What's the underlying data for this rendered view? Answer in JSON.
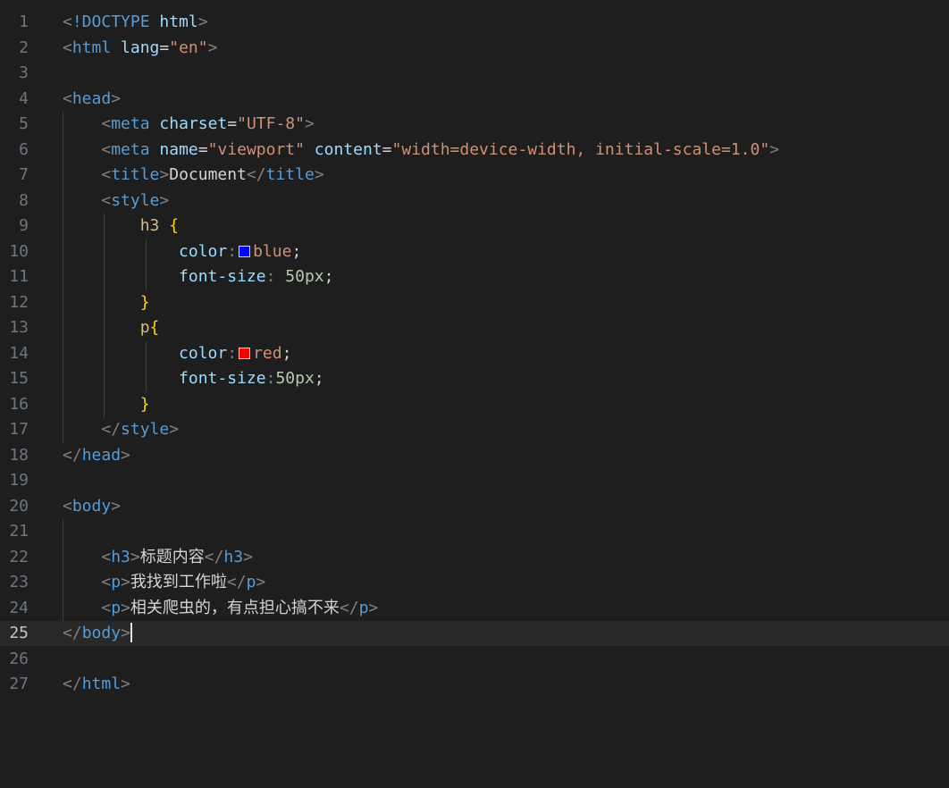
{
  "editor": {
    "current_line": 25,
    "lines": [
      {
        "num": "1",
        "segments": [
          {
            "t": "<",
            "c": "p"
          },
          {
            "t": "!DOCTYPE",
            "c": "t"
          },
          {
            "t": " html",
            "c": "a"
          },
          {
            "t": ">",
            "c": "p"
          }
        ]
      },
      {
        "num": "2",
        "segments": [
          {
            "t": "<",
            "c": "p"
          },
          {
            "t": "html",
            "c": "t"
          },
          {
            "t": " lang",
            "c": "a"
          },
          {
            "t": "=",
            "c": "x"
          },
          {
            "t": "\"en\"",
            "c": "s"
          },
          {
            "t": ">",
            "c": "p"
          }
        ]
      },
      {
        "num": "3",
        "segments": []
      },
      {
        "num": "4",
        "segments": [
          {
            "t": "<",
            "c": "p"
          },
          {
            "t": "head",
            "c": "t"
          },
          {
            "t": ">",
            "c": "p"
          }
        ]
      },
      {
        "num": "5",
        "segments": [
          {
            "t": "    ",
            "c": "x"
          },
          {
            "t": "<",
            "c": "p"
          },
          {
            "t": "meta",
            "c": "t"
          },
          {
            "t": " charset",
            "c": "a"
          },
          {
            "t": "=",
            "c": "x"
          },
          {
            "t": "\"UTF-8\"",
            "c": "s"
          },
          {
            "t": ">",
            "c": "p"
          }
        ]
      },
      {
        "num": "6",
        "segments": [
          {
            "t": "    ",
            "c": "x"
          },
          {
            "t": "<",
            "c": "p"
          },
          {
            "t": "meta",
            "c": "t"
          },
          {
            "t": " name",
            "c": "a"
          },
          {
            "t": "=",
            "c": "x"
          },
          {
            "t": "\"viewport\"",
            "c": "s"
          },
          {
            "t": " content",
            "c": "a"
          },
          {
            "t": "=",
            "c": "x"
          },
          {
            "t": "\"width=device-width, initial-scale=1.0\"",
            "c": "s"
          },
          {
            "t": ">",
            "c": "p"
          }
        ]
      },
      {
        "num": "7",
        "segments": [
          {
            "t": "    ",
            "c": "x"
          },
          {
            "t": "<",
            "c": "p"
          },
          {
            "t": "title",
            "c": "t"
          },
          {
            "t": ">",
            "c": "p"
          },
          {
            "t": "Document",
            "c": "x"
          },
          {
            "t": "</",
            "c": "p"
          },
          {
            "t": "title",
            "c": "t"
          },
          {
            "t": ">",
            "c": "p"
          }
        ]
      },
      {
        "num": "8",
        "segments": [
          {
            "t": "    ",
            "c": "x"
          },
          {
            "t": "<",
            "c": "p"
          },
          {
            "t": "style",
            "c": "t"
          },
          {
            "t": ">",
            "c": "p"
          }
        ]
      },
      {
        "num": "9",
        "segments": [
          {
            "t": "        ",
            "c": "x"
          },
          {
            "t": "h3",
            "c": "sel"
          },
          {
            "t": " {",
            "c": "br"
          }
        ]
      },
      {
        "num": "10",
        "segments": [
          {
            "t": "            ",
            "c": "x"
          },
          {
            "t": "color",
            "c": "prop"
          },
          {
            "t": ":",
            "c": "ph"
          },
          {
            "swatch": "#0000ff"
          },
          {
            "t": "blue",
            "c": "val"
          },
          {
            "t": ";",
            "c": "x"
          }
        ]
      },
      {
        "num": "11",
        "segments": [
          {
            "t": "            ",
            "c": "x"
          },
          {
            "t": "font-size",
            "c": "prop"
          },
          {
            "t": ": ",
            "c": "ph"
          },
          {
            "t": "50px",
            "c": "num"
          },
          {
            "t": ";",
            "c": "x"
          }
        ]
      },
      {
        "num": "12",
        "segments": [
          {
            "t": "        ",
            "c": "x"
          },
          {
            "t": "}",
            "c": "br"
          }
        ]
      },
      {
        "num": "13",
        "segments": [
          {
            "t": "        ",
            "c": "x"
          },
          {
            "t": "p",
            "c": "sel"
          },
          {
            "t": "{",
            "c": "br"
          }
        ]
      },
      {
        "num": "14",
        "segments": [
          {
            "t": "            ",
            "c": "x"
          },
          {
            "t": "color",
            "c": "prop"
          },
          {
            "t": ":",
            "c": "ph"
          },
          {
            "swatch": "#ff0000"
          },
          {
            "t": "red",
            "c": "val"
          },
          {
            "t": ";",
            "c": "x"
          }
        ]
      },
      {
        "num": "15",
        "segments": [
          {
            "t": "            ",
            "c": "x"
          },
          {
            "t": "font-size",
            "c": "prop"
          },
          {
            "t": ":",
            "c": "ph"
          },
          {
            "t": "50px",
            "c": "num"
          },
          {
            "t": ";",
            "c": "x"
          }
        ]
      },
      {
        "num": "16",
        "segments": [
          {
            "t": "        ",
            "c": "x"
          },
          {
            "t": "}",
            "c": "br"
          }
        ]
      },
      {
        "num": "17",
        "segments": [
          {
            "t": "    ",
            "c": "x"
          },
          {
            "t": "</",
            "c": "p"
          },
          {
            "t": "style",
            "c": "t"
          },
          {
            "t": ">",
            "c": "p"
          }
        ]
      },
      {
        "num": "18",
        "segments": [
          {
            "t": "</",
            "c": "p"
          },
          {
            "t": "head",
            "c": "t"
          },
          {
            "t": ">",
            "c": "p"
          }
        ]
      },
      {
        "num": "19",
        "segments": []
      },
      {
        "num": "20",
        "segments": [
          {
            "t": "<",
            "c": "p"
          },
          {
            "t": "body",
            "c": "t"
          },
          {
            "t": ">",
            "c": "p"
          }
        ]
      },
      {
        "num": "21",
        "segments": []
      },
      {
        "num": "22",
        "segments": [
          {
            "t": "    ",
            "c": "x"
          },
          {
            "t": "<",
            "c": "p"
          },
          {
            "t": "h3",
            "c": "t"
          },
          {
            "t": ">",
            "c": "p"
          },
          {
            "t": "标题内容",
            "c": "x"
          },
          {
            "t": "</",
            "c": "p"
          },
          {
            "t": "h3",
            "c": "t"
          },
          {
            "t": ">",
            "c": "p"
          }
        ]
      },
      {
        "num": "23",
        "segments": [
          {
            "t": "    ",
            "c": "x"
          },
          {
            "t": "<",
            "c": "p"
          },
          {
            "t": "p",
            "c": "t"
          },
          {
            "t": ">",
            "c": "p"
          },
          {
            "t": "我找到工作啦",
            "c": "x"
          },
          {
            "t": "</",
            "c": "p"
          },
          {
            "t": "p",
            "c": "t"
          },
          {
            "t": ">",
            "c": "p"
          }
        ]
      },
      {
        "num": "24",
        "segments": [
          {
            "t": "    ",
            "c": "x"
          },
          {
            "t": "<",
            "c": "p"
          },
          {
            "t": "p",
            "c": "t"
          },
          {
            "t": ">",
            "c": "p"
          },
          {
            "t": "相关爬虫的，有点担心搞不来",
            "c": "x"
          },
          {
            "t": "</",
            "c": "p"
          },
          {
            "t": "p",
            "c": "t"
          },
          {
            "t": ">",
            "c": "p"
          }
        ]
      },
      {
        "num": "25",
        "segments": [
          {
            "t": "</",
            "c": "p"
          },
          {
            "t": "body",
            "c": "t"
          },
          {
            "t": ">",
            "c": "p"
          },
          {
            "cursor": true
          }
        ]
      },
      {
        "num": "26",
        "segments": []
      },
      {
        "num": "27",
        "segments": [
          {
            "t": "</",
            "c": "p"
          },
          {
            "t": "html",
            "c": "t"
          },
          {
            "t": ">",
            "c": "p"
          }
        ]
      }
    ]
  }
}
